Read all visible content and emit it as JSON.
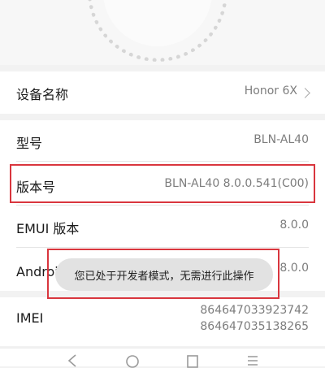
{
  "device_info": {
    "device_name": {
      "label": "设备名称",
      "value": "Honor 6X"
    },
    "model": {
      "label": "型号",
      "value": "BLN-AL40"
    },
    "build_number": {
      "label": "版本号",
      "value": "BLN-AL40 8.0.0.541(C00)"
    },
    "emui_version": {
      "label": "EMUI 版本",
      "value": "8.0.0"
    },
    "android_version": {
      "label": "Android 版本",
      "value": "8.0.0"
    },
    "imei": {
      "label": "IMEI",
      "values": [
        "864647033923742",
        "864647035138265"
      ]
    }
  },
  "toast": {
    "message": "您已处于开发者模式，无需进行此操作"
  },
  "icons": {
    "header": "dial-decoration",
    "device_name_action": "chevron-right-icon",
    "nav": [
      "back-icon",
      "home-icon",
      "recents-icon",
      "menu-icon"
    ]
  },
  "colors": {
    "highlight": "#d9363e",
    "background": "#f2f2f2",
    "secondary_text": "#7d7d7d",
    "toast_background": "#e2e2e2"
  }
}
